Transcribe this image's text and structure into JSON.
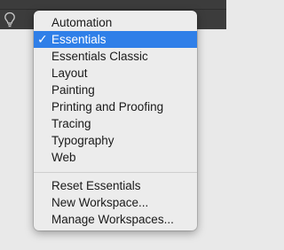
{
  "toolbar": {
    "icon": "lightbulb-icon"
  },
  "menu": {
    "workspaces": [
      {
        "label": "Automation",
        "checked": false
      },
      {
        "label": "Essentials",
        "checked": true
      },
      {
        "label": "Essentials Classic",
        "checked": false
      },
      {
        "label": "Layout",
        "checked": false
      },
      {
        "label": "Painting",
        "checked": false
      },
      {
        "label": "Printing and Proofing",
        "checked": false
      },
      {
        "label": "Tracing",
        "checked": false
      },
      {
        "label": "Typography",
        "checked": false
      },
      {
        "label": "Web",
        "checked": false
      }
    ],
    "checkmark": "✓",
    "actions": [
      {
        "label": "Reset Essentials"
      },
      {
        "label": "New Workspace..."
      },
      {
        "label": "Manage Workspaces..."
      }
    ]
  },
  "colors": {
    "highlight": "#2f7fe8",
    "toolbar_bg": "#3c3c3c"
  }
}
